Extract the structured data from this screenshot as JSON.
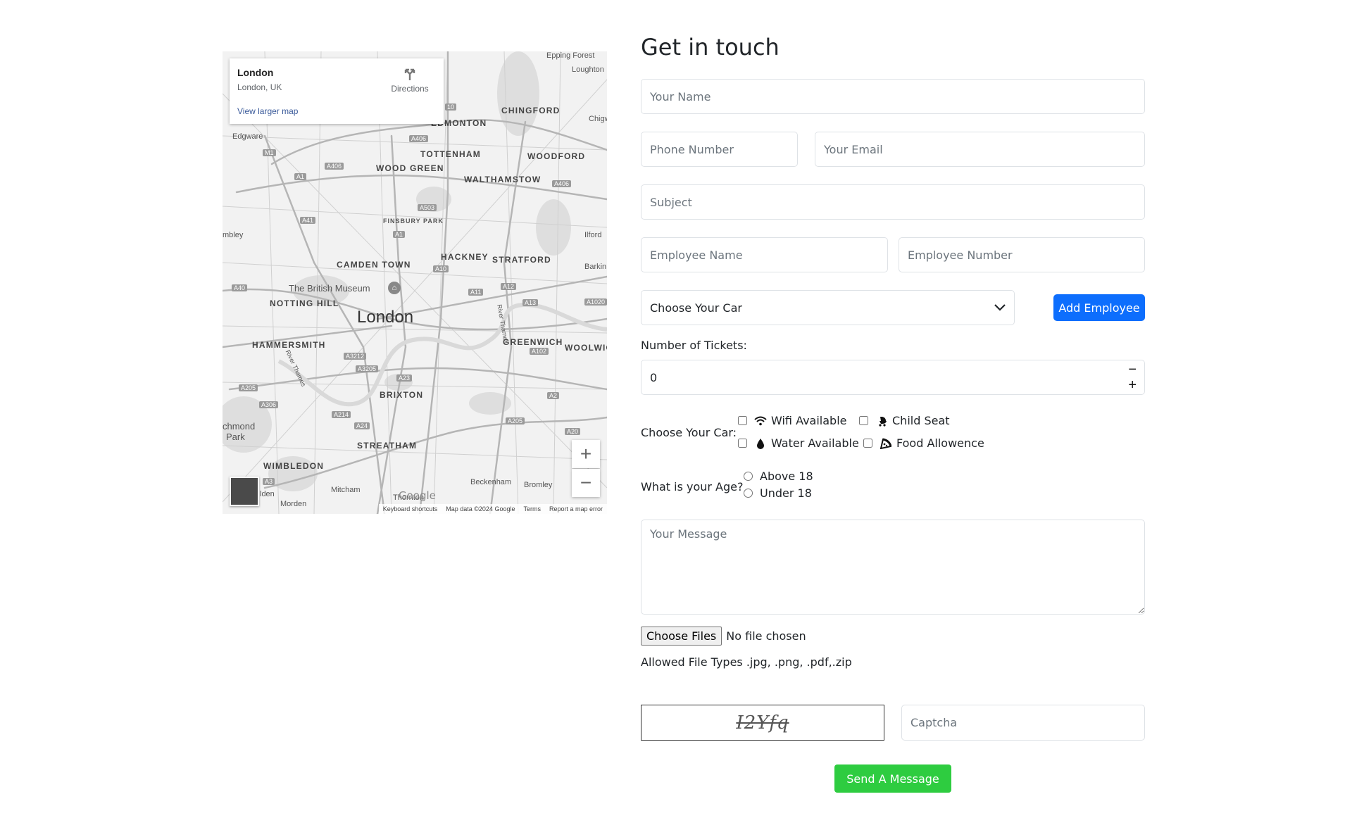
{
  "map": {
    "card": {
      "place": "London",
      "address": "London, UK",
      "view_larger": "View larger map",
      "directions": "Directions"
    },
    "labels": {
      "epping_forest": "Epping Forest",
      "loughton": "Loughton",
      "chingford": "CHINGFORD",
      "edmonton": "EDMONTON",
      "chigwell": "Chigw",
      "edgware": "Edgware",
      "tottenham": "TOTTENHAM",
      "woodford": "WOODFORD",
      "wood_green": "WOOD GREEN",
      "walthamstow": "WALTHAMSTOW",
      "finsbury_park": "FINSBURY PARK",
      "wembley": "mbley",
      "ilford": "Ilford",
      "camden_town": "CAMDEN TOWN",
      "hackney": "HACKNEY",
      "stratford": "STRATFORD",
      "barking": "Barkin",
      "british_museum": "The British Museum",
      "notting_hill": "NOTTING HILL",
      "london": "London",
      "hammersmith": "HAMMERSMITH",
      "greenwich": "GREENWICH",
      "woolwich": "WOOLWIC",
      "brixton": "BRIXTON",
      "richmond_1": "chmond",
      "richmond_2": "Park",
      "streatham": "STREATHAM",
      "wimbledon": "WIMBLEDON",
      "beckenham": "Beckenham",
      "bromley": "Bromley",
      "mitcham": "Mitcham",
      "morden": "Morden",
      "thornton": "Thornton",
      "malden": "lden",
      "thames_1": "River Thames",
      "thames_2": "River Thames"
    },
    "roads": [
      "A406",
      "A406",
      "M1",
      "A1",
      "A503",
      "A41",
      "A1",
      "A406",
      "A10",
      "A11",
      "A12",
      "A13",
      "A40",
      "A1020",
      "A3212",
      "A3205",
      "A23",
      "A102",
      "A205",
      "A306",
      "A214",
      "A24",
      "A205",
      "A2",
      "A20",
      "A3",
      "10"
    ],
    "zoom_in": "+",
    "zoom_out": "−",
    "google": "Google",
    "attribution": {
      "shortcuts": "Keyboard shortcuts",
      "data": "Map data ©2024 Google",
      "terms": "Terms",
      "report": "Report a map error"
    }
  },
  "form": {
    "title": "Get in touch",
    "name_placeholder": "Your Name",
    "phone_placeholder": "Phone Number",
    "email_placeholder": "Your Email",
    "subject_placeholder": "Subject",
    "employee_name_placeholder": "Employee Name",
    "employee_number_placeholder": "Employee Number",
    "car_select_value": "Choose Your Car",
    "add_employee_label": "Add Employee",
    "tickets_label": "Number of Tickets:",
    "tickets_value": "0",
    "tickets_minus": "−",
    "tickets_plus": "+",
    "options_label": "Choose Your Car:",
    "options": {
      "wifi": "Wifi Available",
      "child_seat": "Child Seat",
      "water": "Water Available",
      "food": "Food Allowence"
    },
    "age_label": "What is your Age?",
    "age_options": {
      "above": "Above 18",
      "under": "Under 18"
    },
    "message_placeholder": "Your Message",
    "file_button": "Choose Files",
    "file_status": "No file chosen",
    "file_types": "Allowed File Types .jpg, .png, .pdf,.zip",
    "captcha_text": "I2Yfq",
    "captcha_placeholder": "Captcha",
    "submit_label": "Send A Message"
  },
  "colors": {
    "primary": "#0d6efd",
    "success": "#2ecc40"
  }
}
